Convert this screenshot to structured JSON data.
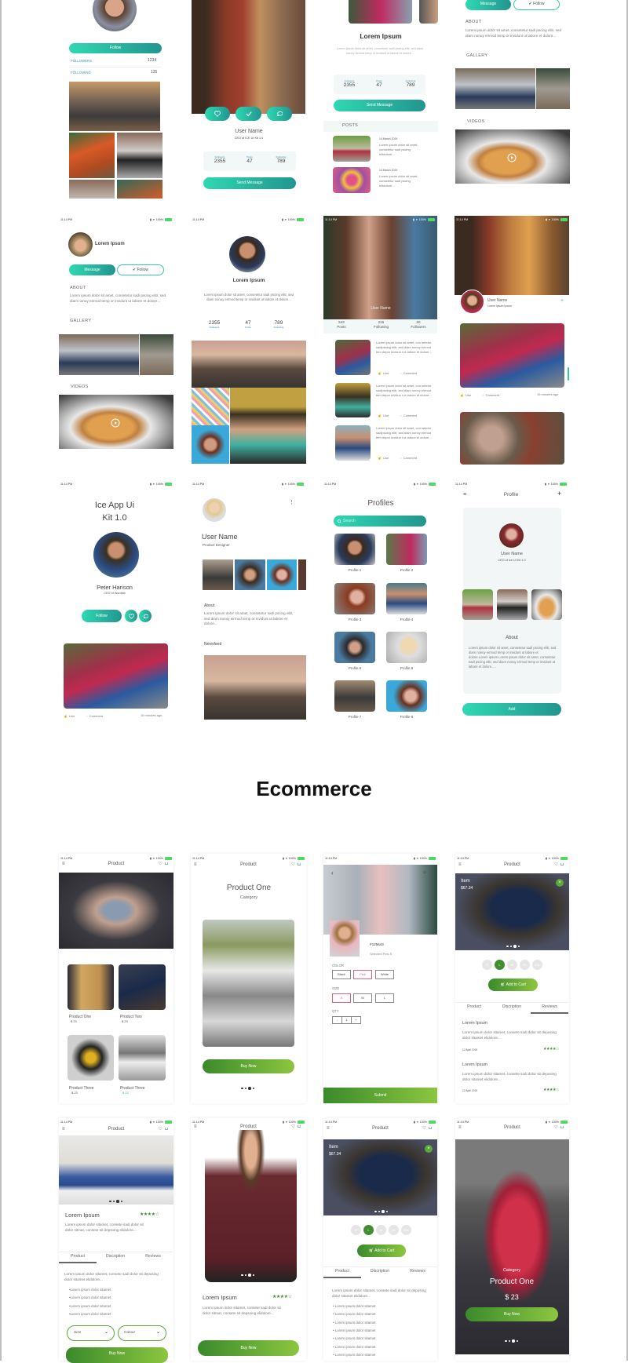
{
  "status": {
    "time": "11:14 PM",
    "battery": "100%"
  },
  "colors": {
    "teal_start": "#2fd8b2",
    "teal_end": "#22958f",
    "green_start": "#3a8a2c",
    "green_end": "#8cc63f",
    "battery": "#4cd964"
  },
  "lorem": {
    "about": "Lorem ipsum dolor sit amet, consetetur sadi pscing elitr, sed diam nonuy eirmod temp or invidunt ut labore et dolore...",
    "post": "Lorem ipsum dolor sit amet, consetetur sadi pscing elitdolore...",
    "feed": "Lorem ipsum dolor sit amet, con setetur sadipscing elitr, sed diam nonuy eirmod tem depor invidun t ut labore et dolore...",
    "long": "Lorem ipsum dolor sit amet, consetetur sadi pscing elitr, sed diam nonuy eirmod temp or invidunt ut labore et dolore.Lorem ipsum Lorem ipsum dolor sit amet, consetetur sadi pscing elitr, sed diam nonuy eirmod temp or invidunt ut labore et dolore.....",
    "review": "Lorem ipsum dolor sitamet, consete sadi dolor sit deposing dolor sitamet elidolore...",
    "product": "Lorem ipsum dolor sitamet, consete sadi dolor sit dolor sitmat, consete sit depsoing elidolore...",
    "bullet": "Lorem ipsum dolor sitamet"
  },
  "common": {
    "follow": "Follow",
    "follow_check": "✔ Follow",
    "message": "Message",
    "send_message": "Send Message",
    "about": "ABOUT",
    "gallery": "GALLERY",
    "videos": "VIDEOS",
    "posts": "POSTS",
    "like": "Like",
    "comment": "Comment",
    "minutes_ago": "15 minutes ago",
    "lorem_ipsum": "Lorem Ipsum",
    "user_name": "User Name",
    "followers": "Followers",
    "posts_label": "Posts",
    "following": "Following",
    "followers_v": "2355",
    "posts_v": "47",
    "following_v": "789"
  },
  "s1": {
    "followers_label": "FOLLOWERS",
    "followers": "1234",
    "following_label": "FOLLOWING",
    "following": "135"
  },
  "s2": {
    "subtitle": "CEO of ICE UI Kit 1.0"
  },
  "s3": {
    "post_date": "14 March 2019"
  },
  "s7": {
    "posts": "543",
    "posts_label": "Posts",
    "following": "226",
    "following_label": "Following",
    "followers": "60",
    "followers_label": "Followers",
    "overlay_name": "User Name"
  },
  "s8": {
    "subtitle": "Lorem Ipsum Ipsum",
    "plus": "+"
  },
  "s9": {
    "title_line1": "Ice App Ui",
    "title_line2": "Kit 1.0",
    "name": "Peter Harison",
    "role": "CEO of Wordlab"
  },
  "s10": {
    "role": "Product Designer",
    "about": "About",
    "newsfeed": "Newsfeed"
  },
  "s11": {
    "title": "Profiles",
    "search_placeholder": "Search",
    "profiles": [
      "Profile 1",
      "Profile 2",
      "Profile 3",
      "Profile 4",
      "Profile 5",
      "Profile 6",
      "Profile 7",
      "Profile 8"
    ]
  },
  "s12": {
    "title": "Profile",
    "subtitle": "CEO of Ice UI Kit 1.0",
    "about": "About",
    "add": "Add"
  },
  "section_title": "Ecommerce",
  "shop": {
    "header_title": "Product",
    "buy_now": "Buy Now",
    "add_to_cart": "Add to Cart",
    "tabs": [
      "Product",
      "Discription",
      "Reviews"
    ],
    "item_label": "Item",
    "item_price": "$67.34",
    "sizes": [
      "S",
      "L",
      "M",
      "XL",
      "XXL"
    ],
    "rating": 4
  },
  "e1": {
    "products": [
      {
        "name": "Product One",
        "price": "$ 23"
      },
      {
        "name": "Product Two",
        "price": "$ 23"
      },
      {
        "name": "Product Three",
        "price": "$ 23"
      },
      {
        "name": "Product Three",
        "price": "$ 23"
      }
    ]
  },
  "e2": {
    "title": "Product One",
    "category": "Category"
  },
  "e3": {
    "sku": "F125643",
    "selected": "Selected   Pink  S",
    "color_label": "COLOR",
    "colors": [
      "Black",
      "Pink",
      "White"
    ],
    "size_label": "SIZE",
    "size_opts": [
      "S",
      "M",
      "L"
    ],
    "qty_label": "QTY",
    "qty": "1",
    "minus": "-",
    "plus": "+",
    "submit": "Submit"
  },
  "e4": {
    "reviews": [
      {
        "title": "Lorem Ipsum",
        "date": "12 April 2019"
      },
      {
        "title": "Lorem Ipsum",
        "date": "12 April 2019"
      }
    ]
  },
  "e5": {
    "size": "Size",
    "colour": "Colour"
  },
  "e8": {
    "category": "Category",
    "title": "Product One",
    "price": "$ 23"
  }
}
